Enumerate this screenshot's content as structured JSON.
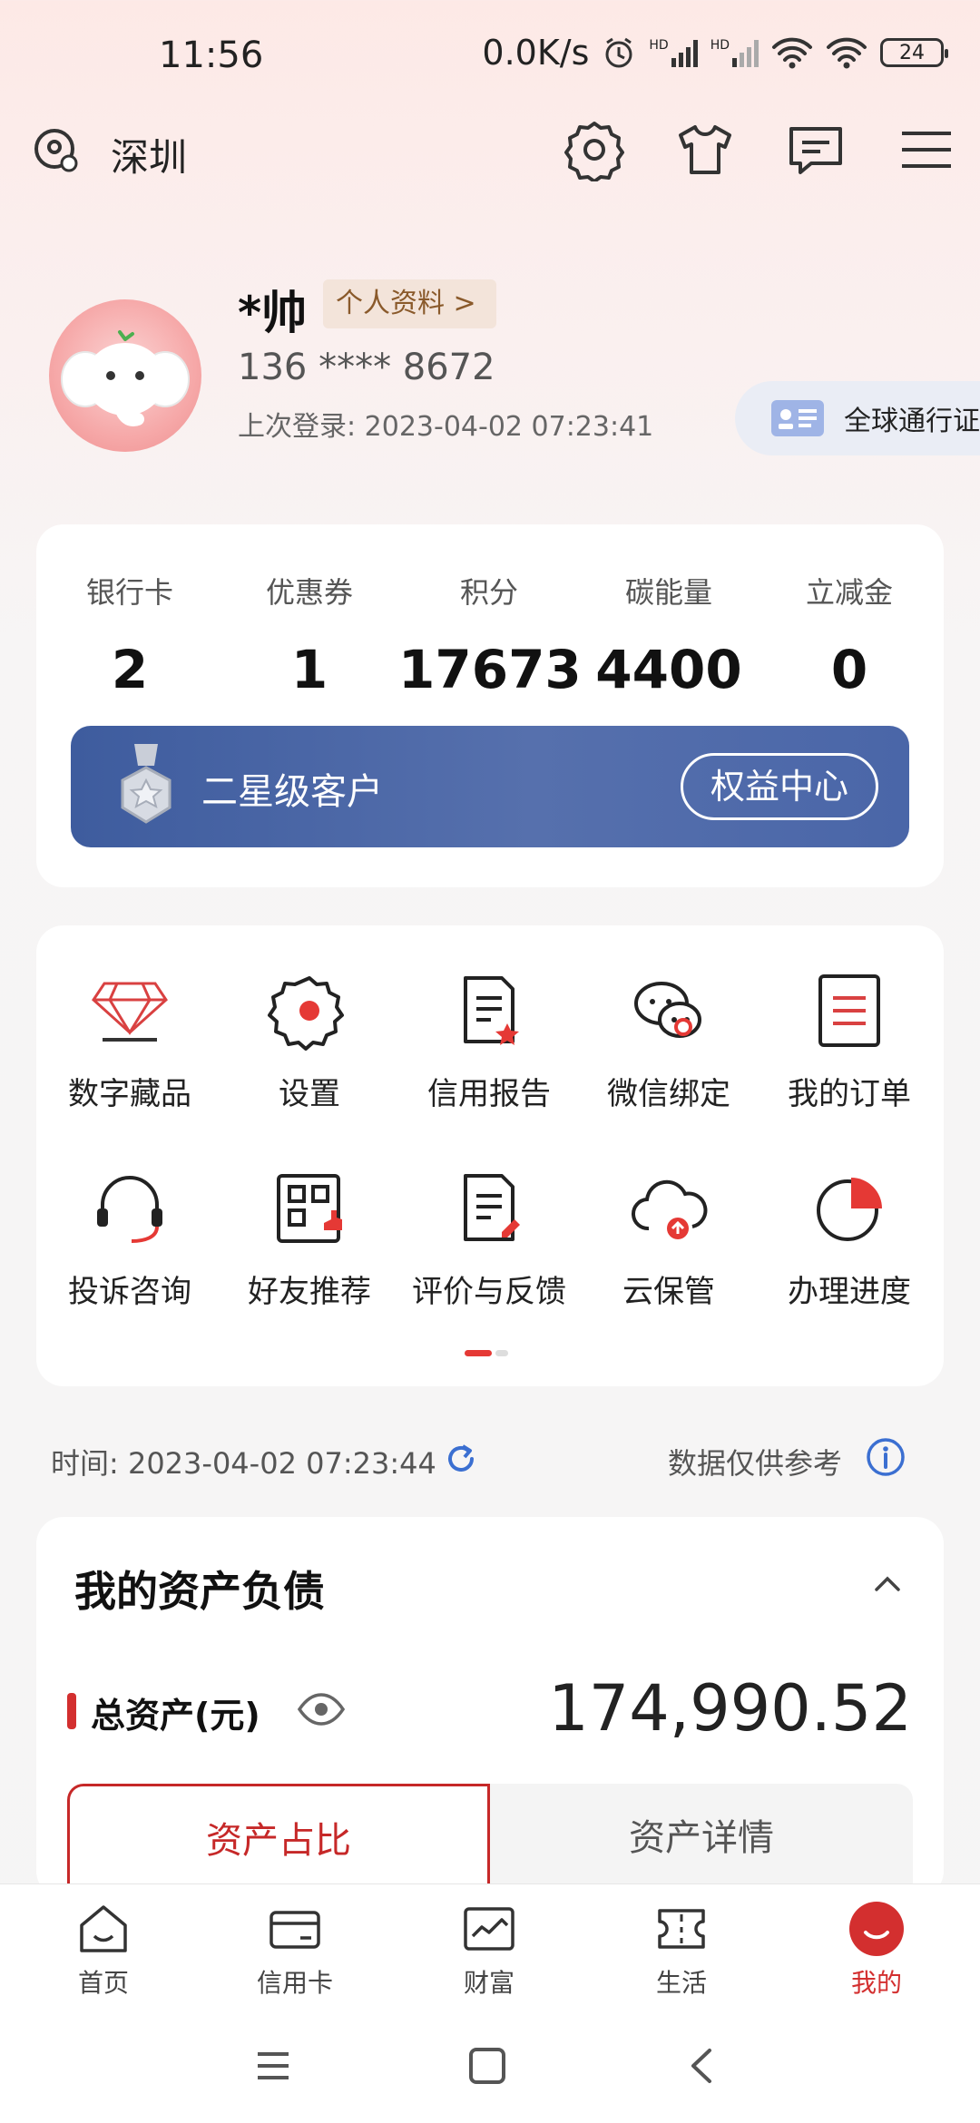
{
  "status_bar": {
    "time": "11:56",
    "net_speed": "0.0K/s",
    "battery": "24",
    "hd1": "HD",
    "hd2": "HD"
  },
  "header": {
    "city": "深圳",
    "icons": [
      "location-icon",
      "settings-icon",
      "tshirt-icon",
      "message-icon",
      "menu-icon"
    ]
  },
  "profile": {
    "name": "*帅",
    "profile_button": "个人资料 >",
    "phone": "136 **** 8672",
    "last_login": "上次登录: 2023-04-02 07:23:41",
    "global_pass": "全球通行证"
  },
  "stats": [
    {
      "label": "银行卡",
      "value": "2"
    },
    {
      "label": "优惠券",
      "value": "1"
    },
    {
      "label": "积分",
      "value": "17673"
    },
    {
      "label": "碳能量",
      "value": "4400"
    },
    {
      "label": "立减金",
      "value": "0"
    }
  ],
  "vip": {
    "level": "二星级客户",
    "button": "权益中心"
  },
  "grid": [
    {
      "label": "数字藏品",
      "icon": "diamond-icon"
    },
    {
      "label": "设置",
      "icon": "gear-icon"
    },
    {
      "label": "信用报告",
      "icon": "credit-report-icon"
    },
    {
      "label": "微信绑定",
      "icon": "wechat-icon"
    },
    {
      "label": "我的订单",
      "icon": "orders-icon"
    },
    {
      "label": "投诉咨询",
      "icon": "headset-icon"
    },
    {
      "label": "好友推荐",
      "icon": "qr-recommend-icon"
    },
    {
      "label": "评价与反馈",
      "icon": "feedback-icon"
    },
    {
      "label": "云保管",
      "icon": "cloud-icon"
    },
    {
      "label": "办理进度",
      "icon": "progress-pie-icon"
    }
  ],
  "info_row": {
    "time": "时间: 2023-04-02 07:23:44",
    "note": "数据仅供参考"
  },
  "assets": {
    "title": "我的资产负债",
    "total_label": "总资产(元)",
    "total_value": "174,990.52",
    "tab_a": "资产占比",
    "tab_b": "资产详情"
  },
  "bottom_nav": [
    {
      "label": "首页",
      "icon": "home-icon"
    },
    {
      "label": "信用卡",
      "icon": "card-icon"
    },
    {
      "label": "财富",
      "icon": "wealth-icon"
    },
    {
      "label": "生活",
      "icon": "life-icon"
    },
    {
      "label": "我的",
      "icon": "me-icon"
    }
  ],
  "colors": {
    "brand_red": "#d32f2f",
    "vip_blue": "#4a66a8",
    "accent_blue": "#3b6fd1"
  }
}
